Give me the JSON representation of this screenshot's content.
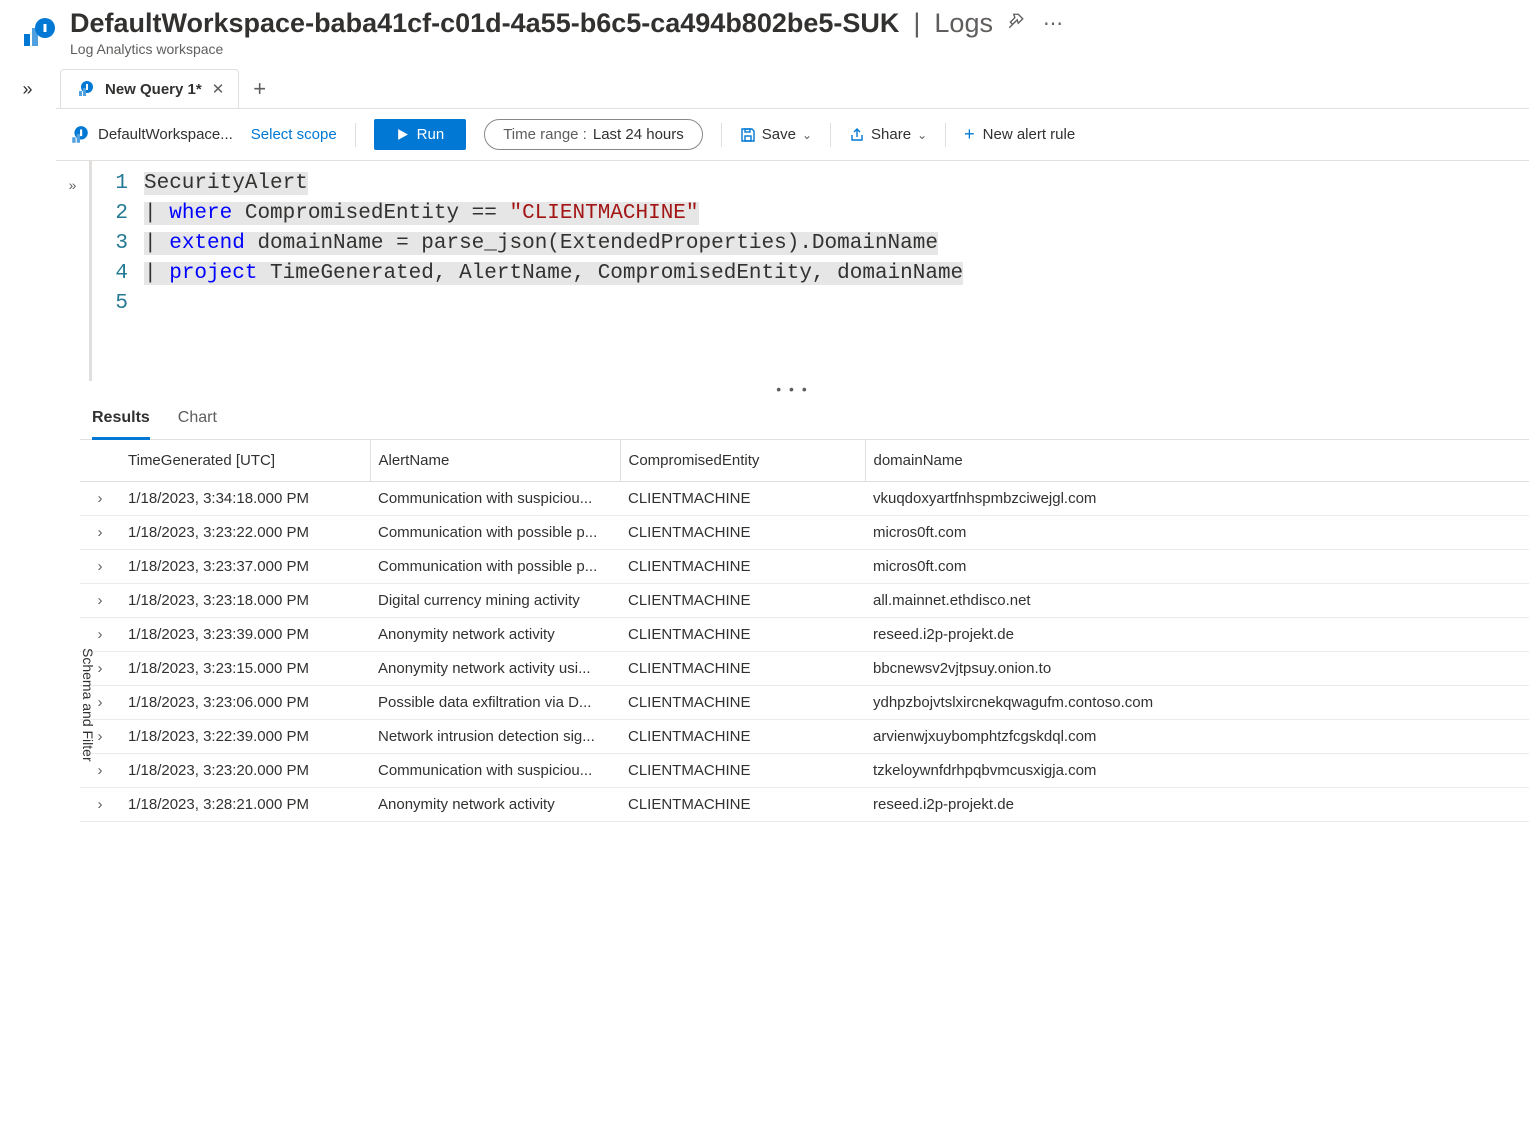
{
  "header": {
    "title": "DefaultWorkspace-baba41cf-c01d-4a55-b6c5-ca494b802be5-SUK",
    "section": "Logs",
    "subtitle": "Log Analytics workspace"
  },
  "tabs": {
    "active_label": "New Query 1*"
  },
  "toolbar": {
    "workspace_short": "DefaultWorkspace...",
    "select_scope": "Select scope",
    "run": "Run",
    "time_label": "Time range :",
    "time_value": "Last 24 hours",
    "save": "Save",
    "share": "Share",
    "new_alert": "New alert rule"
  },
  "editor": {
    "lines": [
      {
        "n": 1,
        "segments": [
          {
            "cls": "hl1 tok-plain",
            "t": "SecurityAlert"
          }
        ]
      },
      {
        "n": 2,
        "segments": [
          {
            "cls": "hl1",
            "t": "| "
          },
          {
            "cls": "hl1 tok-kw",
            "t": "where"
          },
          {
            "cls": "hl1",
            "t": " CompromisedEntity == "
          },
          {
            "cls": "hl1 tok-str",
            "t": "\"CLIENTMACHINE\""
          }
        ]
      },
      {
        "n": 3,
        "segments": [
          {
            "cls": "hl1",
            "t": "| "
          },
          {
            "cls": "hl1 tok-kw",
            "t": "extend"
          },
          {
            "cls": "hl1",
            "t": " domainName = parse_json(ExtendedProperties).DomainName"
          }
        ]
      },
      {
        "n": 4,
        "segments": [
          {
            "cls": "hl1",
            "t": "| "
          },
          {
            "cls": "hl1 tok-kw",
            "t": "project"
          },
          {
            "cls": "hl1",
            "t": " TimeGenerated, AlertName, CompromisedEntity, domainName"
          }
        ]
      },
      {
        "n": 5,
        "segments": [
          {
            "cls": "",
            "t": ""
          }
        ]
      }
    ]
  },
  "results": {
    "tab_results": "Results",
    "tab_chart": "Chart",
    "columns": [
      "TimeGenerated [UTC]",
      "AlertName",
      "CompromisedEntity",
      "domainName"
    ],
    "rows": [
      {
        "time": "1/18/2023, 3:34:18.000 PM",
        "alert": "Communication with suspiciou...",
        "ce": "CLIENTMACHINE",
        "dn": "vkuqdoxyartfnhspmbzciwejgl.com"
      },
      {
        "time": "1/18/2023, 3:23:22.000 PM",
        "alert": "Communication with possible p...",
        "ce": "CLIENTMACHINE",
        "dn": "micros0ft.com"
      },
      {
        "time": "1/18/2023, 3:23:37.000 PM",
        "alert": "Communication with possible p...",
        "ce": "CLIENTMACHINE",
        "dn": "micros0ft.com"
      },
      {
        "time": "1/18/2023, 3:23:18.000 PM",
        "alert": "Digital currency mining activity",
        "ce": "CLIENTMACHINE",
        "dn": "all.mainnet.ethdisco.net"
      },
      {
        "time": "1/18/2023, 3:23:39.000 PM",
        "alert": "Anonymity network activity",
        "ce": "CLIENTMACHINE",
        "dn": "reseed.i2p-projekt.de"
      },
      {
        "time": "1/18/2023, 3:23:15.000 PM",
        "alert": "Anonymity network activity usi...",
        "ce": "CLIENTMACHINE",
        "dn": "bbcnewsv2vjtpsuy.onion.to"
      },
      {
        "time": "1/18/2023, 3:23:06.000 PM",
        "alert": "Possible data exfiltration via D...",
        "ce": "CLIENTMACHINE",
        "dn": "ydhpzbojvtslxircnekqwagufm.contoso.com"
      },
      {
        "time": "1/18/2023, 3:22:39.000 PM",
        "alert": "Network intrusion detection sig...",
        "ce": "CLIENTMACHINE",
        "dn": "arvienwjxuybomphtzfcgskdql.com"
      },
      {
        "time": "1/18/2023, 3:23:20.000 PM",
        "alert": "Communication with suspiciou...",
        "ce": "CLIENTMACHINE",
        "dn": "tzkeloywnfdrhpqbvmcusxigja.com"
      },
      {
        "time": "1/18/2023, 3:28:21.000 PM",
        "alert": "Anonymity network activity",
        "ce": "CLIENTMACHINE",
        "dn": "reseed.i2p-projekt.de"
      }
    ]
  },
  "schema_label": "Schema and Filter"
}
